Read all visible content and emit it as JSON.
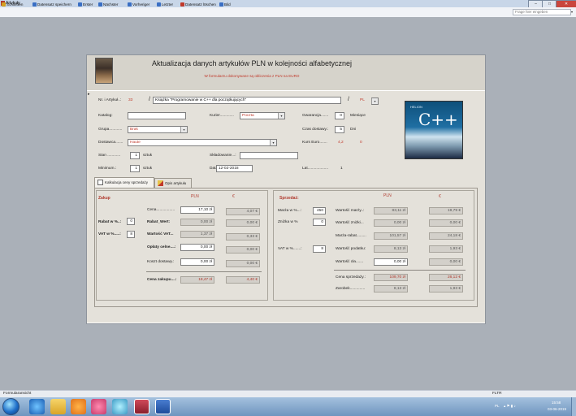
{
  "window": {
    "title": "Artykuły",
    "controls": [
      "–",
      "□",
      "✕"
    ]
  },
  "toolbar": {
    "items": [
      {
        "label": "Schließen",
        "icon": "close-form-icon",
        "color": "#d4a020"
      },
      {
        "label": "Datensatz speichern",
        "icon": "save-record-icon",
        "color": "#3a6fc4"
      },
      {
        "label": "Erster",
        "icon": "first-record-icon",
        "color": "#3a6fc4"
      },
      {
        "label": "Nächster",
        "icon": "next-record-icon",
        "color": "#3a6fc4"
      },
      {
        "label": "Vorheriger",
        "icon": "previous-record-icon",
        "color": "#3a6fc4"
      },
      {
        "label": "Letzter",
        "icon": "last-record-icon",
        "color": "#3a6fc4"
      },
      {
        "label": "Datensatz löschen",
        "icon": "delete-record-icon",
        "color": "#c0392b"
      },
      {
        "label": "Bild",
        "icon": "image-icon",
        "color": "#3a6fc4"
      }
    ],
    "search_placeholder": "Frage hier eingeben"
  },
  "form": {
    "title": "Aktualizacja danych artykułów PLN w kolejności alfabetycznej",
    "subtitle": "W formularzu dokonywane są obliczenia z PLN na  EURO",
    "nr_label": "Nr. i Artykuł..:",
    "nr_value": "33",
    "slash": "/",
    "article": "Książka \"Programowanie w C++ dla początkujących\"",
    "currency": "PL",
    "katalog_label": "Katalog:",
    "katalog_value": "",
    "kurier_label": "Kurier.............",
    "kurier_value": "Poczta",
    "gwarancja_label": "Gwarancja.......",
    "gwarancja_value": "0",
    "gwarancja_unit": "Miesiące",
    "grupa_label": "Grupa............",
    "grupa_value": "Brak",
    "czas_label": "Czas dostawy.:",
    "czas_value": "5",
    "czas_unit": "Dni",
    "dostawca_label": "Dostawca.......",
    "dostawca_value": "Haute",
    "kurs_label": "Kurs Euro.......",
    "kurs_value": "4,2",
    "kurs_extra": "0",
    "stan_label": "Stan ............",
    "stan_value": "1",
    "stan_unit": "sztuk",
    "skladowanie_label": "Składowanie...:",
    "skladowanie_value": "",
    "minimum_label": "Minimum.:",
    "minimum_value": "1",
    "minimum_unit": "sztuk",
    "data_label": "Data zakupu..:",
    "data_value": "12-02-2018",
    "lat_label": "Lat...................",
    "lat_value": "1",
    "book_cover": {
      "brand": "HELION",
      "title": "C++"
    }
  },
  "tabs": [
    {
      "label": "Kalkulacja ceny sprzedaży",
      "active": true
    },
    {
      "label": "Opis artykułu",
      "active": false
    }
  ],
  "zakup": {
    "header": "Zakup",
    "col_pln": "PLN",
    "col_eur": "€",
    "rabat_label": "Rabat w %..:",
    "rabat_value": "0",
    "vat_label": "VAT w %.....:",
    "vat_value": "8",
    "rows": [
      {
        "label": "Cena.................",
        "pln": "17,10 zł",
        "eur": "4,07 €",
        "bold": false
      },
      {
        "label": "Rabat_Wert:",
        "pln": "0,00 zł",
        "eur": "0,00 €",
        "bold": true
      },
      {
        "label": "Wartość VAT...",
        "pln": "1,37 zł",
        "eur": "0,33 €",
        "bold": true
      },
      {
        "label": "Opłaty celne....:",
        "pln": "0,00 zł",
        "eur": "0,00 €",
        "bold": true
      },
      {
        "label": "Koszt dostawy.:",
        "pln": "0,00 zł",
        "eur": "0,00 €",
        "bold": false
      }
    ],
    "total_label": "Cena zakupu....:",
    "total_pln": "18,47 zł",
    "total_eur": "4,40 €"
  },
  "sprzedaz": {
    "header": "Sprzedaż:",
    "col_pln": "PLN",
    "col_eur": "€",
    "marza_label": "Marża  w %...:",
    "marza_value": "450",
    "znizka_label": "Zniżka w %",
    "znizka_value": "0",
    "vat_label": "VAT w %.......:",
    "vat_value": "8",
    "rows": [
      {
        "label": "Wartość marży..:",
        "pln": "83,11 zł",
        "eur": "19,79 €"
      },
      {
        "label": "Wartość zniżki...",
        "pln": "0,00 zł",
        "eur": "0,00 €"
      },
      {
        "label": "Marża-rabat.........",
        "pln": "101,57 zł",
        "eur": "24,18 €"
      },
      {
        "label": "Wartość podatku:",
        "pln": "8,13 zł",
        "eur": "1,93 €"
      },
      {
        "label": "Wartość cła.......",
        "pln": "0,00 zł",
        "eur": "0,00 €"
      }
    ],
    "cena_label": "Cena sprzedaży.:",
    "cena_pln": "109,70 zł",
    "cena_eur": "26,12 €",
    "zarobek_label": "Zarobek..............",
    "zarobek_pln": "8,13 zł",
    "zarobek_eur": "1,93 €"
  },
  "status": {
    "left": "Formularansicht",
    "right": "FLTR"
  },
  "tray": {
    "lang": "PL",
    "time": "15:58",
    "date": "03-06-2019"
  }
}
